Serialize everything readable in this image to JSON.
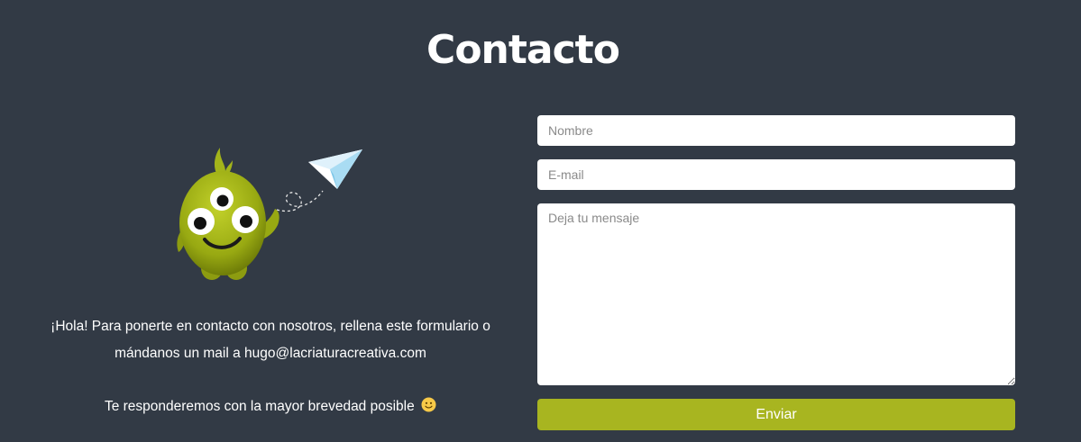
{
  "page": {
    "title": "Contacto"
  },
  "intro": {
    "line1": "¡Hola! Para ponerte en contacto con nosotros, rellena este formulario o",
    "line2": "mándanos un mail a hugo@lacriaturacreativa.com",
    "reply": "Te responderemos con la mayor brevedad posible"
  },
  "form": {
    "name_placeholder": "Nombre",
    "email_placeholder": "E-mail",
    "message_placeholder": "Deja tu mensaje",
    "submit_label": "Enviar"
  },
  "icons": {
    "mascot": "three-eyed-green-monster-icon",
    "plane": "paper-plane-icon",
    "smiley": "smiley-emoji-icon"
  },
  "colors": {
    "background": "#323a45",
    "accent": "#a8b520",
    "text": "#ffffff"
  }
}
